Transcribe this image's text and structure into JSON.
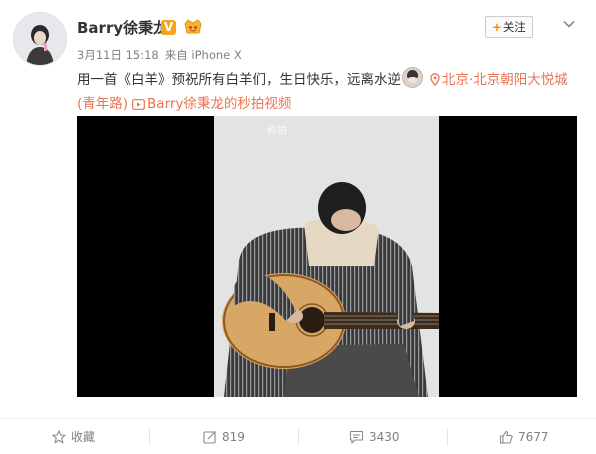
{
  "user": {
    "name": "Barry徐秉龙",
    "verified_mark": "V"
  },
  "meta": {
    "time": "3月11日 15:18",
    "source": "来自 iPhone X"
  },
  "header": {
    "follow_label": "关注"
  },
  "post": {
    "text": "用一首《白羊》预祝所有白羊们，生日快乐，远离水逆",
    "location": "北京·北京朝阳大悦城(青年路)",
    "video_link": "Barry徐秉龙的秒拍视频"
  },
  "video": {
    "watermark": "秒拍"
  },
  "actions": {
    "favorite_label": "收藏",
    "repost_count": "819",
    "comment_count": "3430",
    "like_count": "7677"
  },
  "colors": {
    "link": "#eb7350",
    "accent": "#ff8200",
    "verified": "#f6a31a",
    "meta_text": "#808080"
  },
  "icons": [
    "more-icon",
    "location-pin-icon",
    "video-icon",
    "star-icon",
    "repost-icon",
    "comment-icon",
    "thumbs-up-icon"
  ]
}
